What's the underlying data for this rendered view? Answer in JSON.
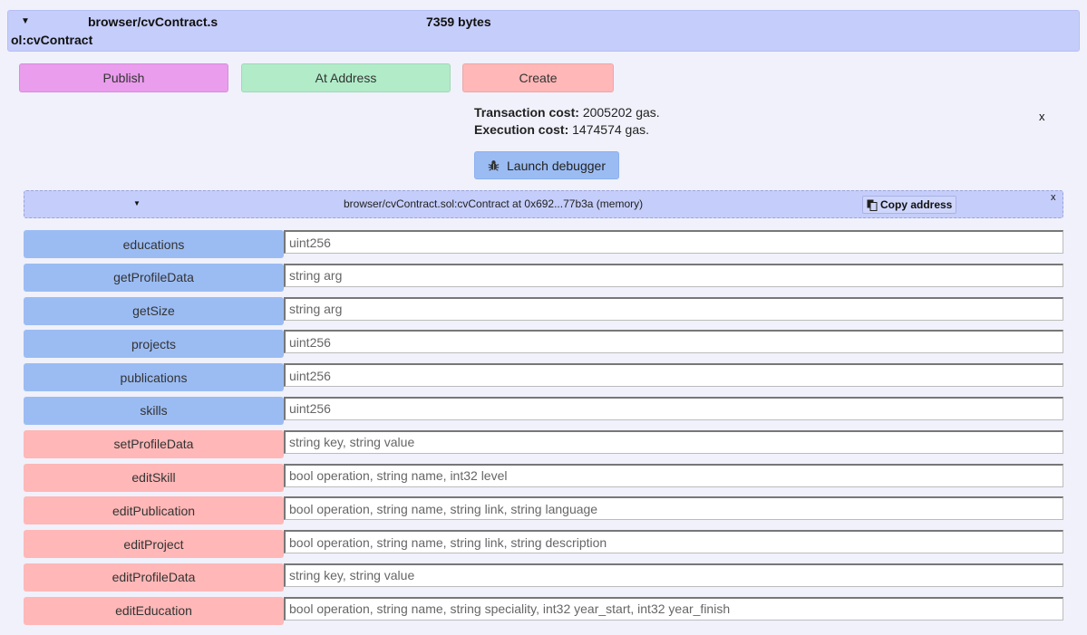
{
  "contract": {
    "caret": "▼",
    "name_line1": "browser/cvContract.s",
    "name_line2": "ol:cvContract",
    "size": "7359 bytes"
  },
  "actions": {
    "publish": "Publish",
    "at_address": "At Address",
    "create": "Create"
  },
  "transaction": {
    "tx_cost_label": "Transaction cost:",
    "tx_cost_value": "2005202 gas.",
    "exec_cost_label": "Execution cost:",
    "exec_cost_value": "1474574 gas.",
    "close": "x"
  },
  "debugger": {
    "label": "Launch debugger",
    "icon": "bug-icon"
  },
  "instance": {
    "caret": "▼",
    "title": "browser/cvContract.sol:cvContract at 0x692...77b3a (memory)",
    "copy_label": "Copy address",
    "copy_icon": "copy-icon",
    "close": "x"
  },
  "functions": [
    {
      "label": "educations",
      "placeholder": "uint256",
      "kind": "call"
    },
    {
      "label": "getProfileData",
      "placeholder": "string arg",
      "kind": "call"
    },
    {
      "label": "getSize",
      "placeholder": "string arg",
      "kind": "call"
    },
    {
      "label": "projects",
      "placeholder": "uint256",
      "kind": "call"
    },
    {
      "label": "publications",
      "placeholder": "uint256",
      "kind": "call"
    },
    {
      "label": "skills",
      "placeholder": "uint256",
      "kind": "call"
    },
    {
      "label": "setProfileData",
      "placeholder": "string key, string value",
      "kind": "tx"
    },
    {
      "label": "editSkill",
      "placeholder": "bool operation, string name, int32 level",
      "kind": "tx"
    },
    {
      "label": "editPublication",
      "placeholder": "bool operation, string name, string link, string language",
      "kind": "tx"
    },
    {
      "label": "editProject",
      "placeholder": "bool operation, string name, string link, string description",
      "kind": "tx"
    },
    {
      "label": "editProfileData",
      "placeholder": "string key, string value",
      "kind": "tx"
    },
    {
      "label": "editEducation",
      "placeholder": "bool operation, string name, string speciality, int32 year_start, int32 year_finish",
      "kind": "tx"
    }
  ],
  "colors": {
    "call": "#9bbcf3",
    "transact": "#ffb7b7",
    "publish": "#ea9ced",
    "at_address": "#b1ebc8",
    "header_bg": "#c5cdfa"
  }
}
